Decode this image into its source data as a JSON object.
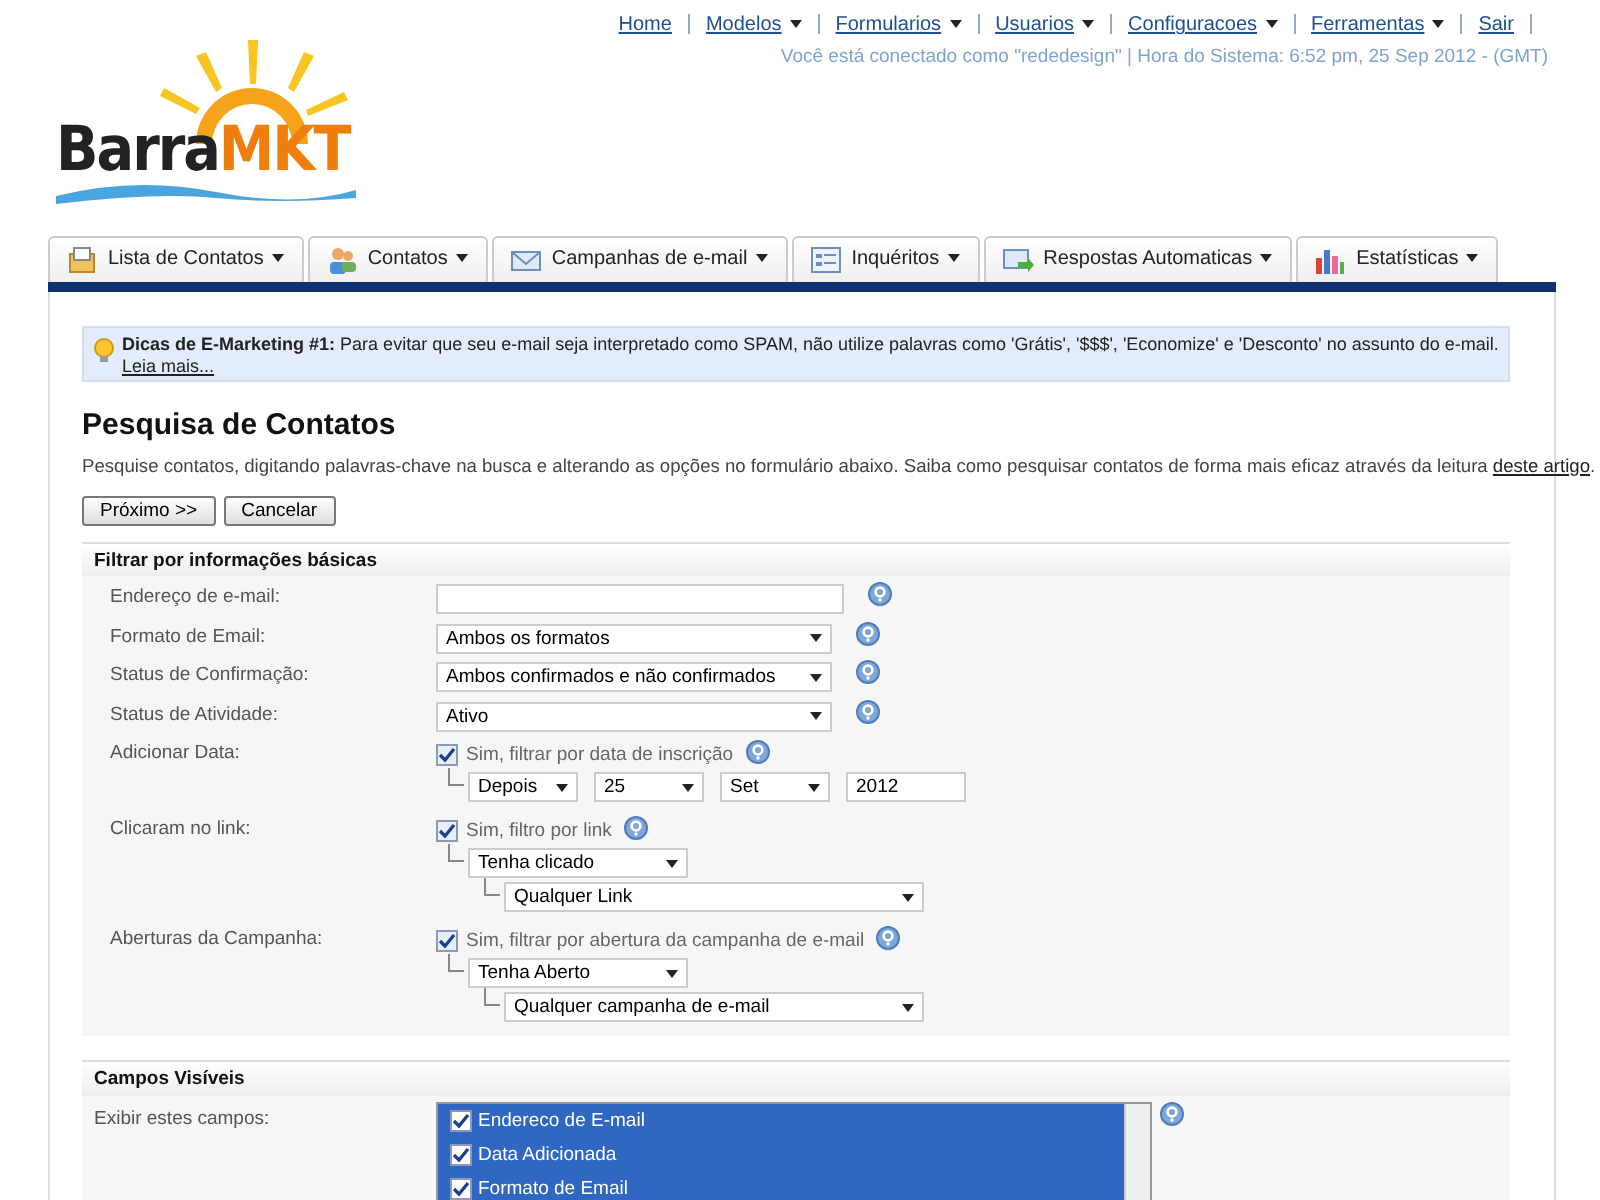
{
  "logo": {
    "text_dark": "Barra",
    "text_accent": "MKT"
  },
  "top_nav": [
    {
      "label": "Home",
      "dropdown": false
    },
    {
      "label": "Modelos",
      "dropdown": true
    },
    {
      "label": "Formularios",
      "dropdown": true
    },
    {
      "label": "Usuarios",
      "dropdown": true
    },
    {
      "label": "Configuracoes",
      "dropdown": true
    },
    {
      "label": "Ferramentas",
      "dropdown": true
    },
    {
      "label": "Sair",
      "dropdown": false
    }
  ],
  "session_info": "Você está conectado como \"rededesign\" | Hora do Sistema: 6:52 pm, 25 Sep 2012 - (GMT)",
  "tabs": [
    {
      "label": "Lista de Contatos",
      "kind": "list"
    },
    {
      "label": "Contatos",
      "kind": "people"
    },
    {
      "label": "Campanhas de e-mail",
      "kind": "mail"
    },
    {
      "label": "Inquéritos",
      "kind": "form"
    },
    {
      "label": "Respostas Automaticas",
      "kind": "autoreply"
    },
    {
      "label": "Estatísticas",
      "kind": "chart"
    }
  ],
  "tip": {
    "text": "**Dicas de E-Marketing #1:** Para evitar que seu e-mail seja interpretado como SPAM, não utilize palavras como 'Grátis', '$$$', 'Economize' e 'Desconto' no assunto do e-mail.",
    "link": "Leia mais..."
  },
  "heading": "Pesquisa de Contatos",
  "intro": {
    "text": "Pesquise contatos, digitando palavras-chave na busca e alterando as opções no formulário abaixo. Saiba como pesquisar contatos de forma mais eficaz através da leitura",
    "link": "deste artigo",
    "after": "."
  },
  "buttons": [
    "Próximo >>",
    "Cancelar"
  ],
  "basic_filter": {
    "title": "Filtrar por informações básicas",
    "rows": [
      {
        "label": "Endereço de e-mail:",
        "kind": "text"
      },
      {
        "label": "Formato de Email:",
        "kind": "select",
        "value": "Ambos os formatos"
      },
      {
        "label": "Status de Confirmação:",
        "kind": "select",
        "value": "Ambos confirmados e não confirmados"
      },
      {
        "label": "Status de Atividade:",
        "kind": "select",
        "value": "Ativo"
      },
      {
        "label": "Adicionar Data:",
        "kind": "filter",
        "check": {
          "label": "Sim, filtrar por data de inscrição",
          "checked": true
        },
        "children": [
          {
            "controls": [
              {
                "kind": "select",
                "value": "Depois"
              },
              {
                "kind": "select",
                "value": "25"
              },
              {
                "kind": "select",
                "value": "Set"
              },
              {
                "kind": "text",
                "value": "2012"
              }
            ]
          }
        ]
      },
      {
        "label": "Clicaram no link:",
        "kind": "filter",
        "check": {
          "label": "Sim, filtro por link",
          "checked": true
        },
        "children": [
          {
            "controls": [
              {
                "kind": "select",
                "value": "Tenha clicado"
              }
            ],
            "children": [
              {
                "controls": [
                  {
                    "kind": "wide-select",
                    "value": "Qualquer Link"
                  }
                ]
              }
            ]
          }
        ]
      },
      {
        "label": "Aberturas da Campanha:",
        "kind": "filter",
        "check": {
          "label": "Sim, filtrar por abertura da campanha de e-mail",
          "checked": true
        },
        "children": [
          {
            "controls": [
              {
                "kind": "select",
                "value": "Tenha Aberto"
              }
            ],
            "children": [
              {
                "controls": [
                  {
                    "kind": "wide-select",
                    "value": "Qualquer campanha de e-mail"
                  }
                ]
              }
            ]
          }
        ]
      }
    ]
  },
  "visible_fields": {
    "title": "Campos Visíveis",
    "label": "Exibir estes campos:",
    "items": [
      {
        "label": "Endereco de E-mail",
        "checked": true
      },
      {
        "label": "Data Adicionada",
        "checked": true
      },
      {
        "label": "Formato de Email",
        "checked": true
      }
    ]
  }
}
